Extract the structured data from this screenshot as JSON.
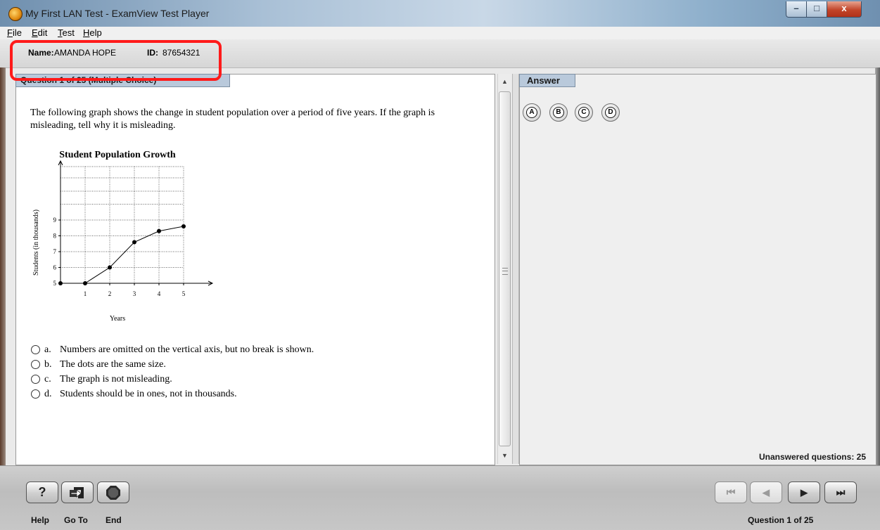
{
  "window": {
    "title": "My First LAN Test - ExamView Test Player",
    "controls": {
      "minimize": "–",
      "maximize": "□",
      "close": "x"
    }
  },
  "menu": [
    {
      "label": "File",
      "key": "F"
    },
    {
      "label": "Edit",
      "key": "E"
    },
    {
      "label": "Test",
      "key": "T"
    },
    {
      "label": "Help",
      "key": "H"
    }
  ],
  "student": {
    "name_label": "Name:",
    "name": "AMANDA HOPE",
    "id_label": "ID:",
    "id": "87654321"
  },
  "question": {
    "tab_label": "Question 1 of 25 (Multiple Choice)",
    "stem": "The following graph shows the change in student population over a period of five years. If the graph is misleading, tell why it is misleading.",
    "choices": [
      {
        "letter": "a.",
        "text": "Numbers are omitted on the vertical axis, but no break is shown."
      },
      {
        "letter": "b.",
        "text": "The dots are the same size."
      },
      {
        "letter": "c.",
        "text": "The graph is not misleading."
      },
      {
        "letter": "d.",
        "text": "Students should be in ones, not in thousands."
      }
    ]
  },
  "chart_data": {
    "type": "line",
    "title": "Student Population Growth",
    "xlabel": "Years",
    "ylabel": "Students (in thousands)",
    "x": [
      0,
      1,
      2,
      3,
      4,
      5
    ],
    "xticks": [
      "1",
      "2",
      "3",
      "4",
      "5"
    ],
    "yticks": [
      "5",
      "6",
      "7",
      "8",
      "9"
    ],
    "values": [
      5,
      5,
      6,
      7.6,
      8.3,
      8.6
    ],
    "grid": true
  },
  "answer": {
    "tab_label": "Answer",
    "options": [
      "A",
      "B",
      "C",
      "D"
    ],
    "unanswered": "Unanswered questions: 25"
  },
  "toolbar": {
    "help_label": "Help",
    "goto_label": "Go To",
    "end_label": "End",
    "help_glyph": "?",
    "first_glyph": "⏮",
    "prev_glyph": "◀",
    "next_glyph": "▶",
    "last_glyph": "⏭",
    "question_counter": "Question 1 of 25"
  }
}
